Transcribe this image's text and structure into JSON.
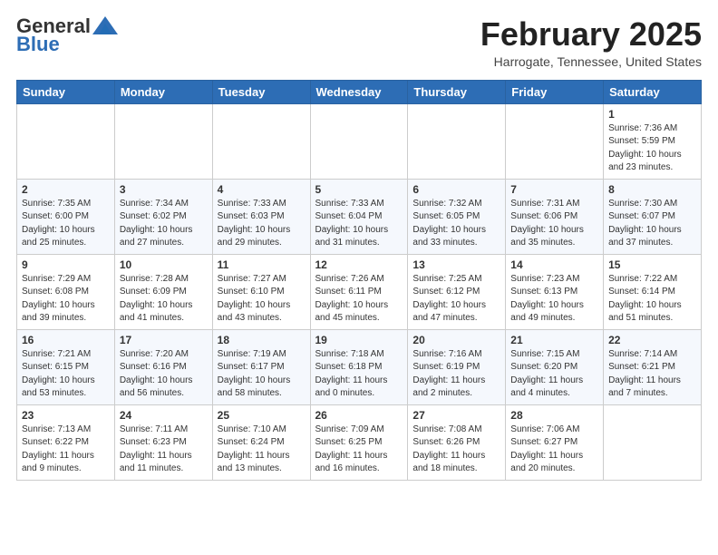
{
  "header": {
    "logo_general": "General",
    "logo_blue": "Blue",
    "month": "February 2025",
    "location": "Harrogate, Tennessee, United States"
  },
  "weekdays": [
    "Sunday",
    "Monday",
    "Tuesday",
    "Wednesday",
    "Thursday",
    "Friday",
    "Saturday"
  ],
  "weeks": [
    [
      {
        "day": "",
        "info": ""
      },
      {
        "day": "",
        "info": ""
      },
      {
        "day": "",
        "info": ""
      },
      {
        "day": "",
        "info": ""
      },
      {
        "day": "",
        "info": ""
      },
      {
        "day": "",
        "info": ""
      },
      {
        "day": "1",
        "info": "Sunrise: 7:36 AM\nSunset: 5:59 PM\nDaylight: 10 hours and 23 minutes."
      }
    ],
    [
      {
        "day": "2",
        "info": "Sunrise: 7:35 AM\nSunset: 6:00 PM\nDaylight: 10 hours and 25 minutes."
      },
      {
        "day": "3",
        "info": "Sunrise: 7:34 AM\nSunset: 6:02 PM\nDaylight: 10 hours and 27 minutes."
      },
      {
        "day": "4",
        "info": "Sunrise: 7:33 AM\nSunset: 6:03 PM\nDaylight: 10 hours and 29 minutes."
      },
      {
        "day": "5",
        "info": "Sunrise: 7:33 AM\nSunset: 6:04 PM\nDaylight: 10 hours and 31 minutes."
      },
      {
        "day": "6",
        "info": "Sunrise: 7:32 AM\nSunset: 6:05 PM\nDaylight: 10 hours and 33 minutes."
      },
      {
        "day": "7",
        "info": "Sunrise: 7:31 AM\nSunset: 6:06 PM\nDaylight: 10 hours and 35 minutes."
      },
      {
        "day": "8",
        "info": "Sunrise: 7:30 AM\nSunset: 6:07 PM\nDaylight: 10 hours and 37 minutes."
      }
    ],
    [
      {
        "day": "9",
        "info": "Sunrise: 7:29 AM\nSunset: 6:08 PM\nDaylight: 10 hours and 39 minutes."
      },
      {
        "day": "10",
        "info": "Sunrise: 7:28 AM\nSunset: 6:09 PM\nDaylight: 10 hours and 41 minutes."
      },
      {
        "day": "11",
        "info": "Sunrise: 7:27 AM\nSunset: 6:10 PM\nDaylight: 10 hours and 43 minutes."
      },
      {
        "day": "12",
        "info": "Sunrise: 7:26 AM\nSunset: 6:11 PM\nDaylight: 10 hours and 45 minutes."
      },
      {
        "day": "13",
        "info": "Sunrise: 7:25 AM\nSunset: 6:12 PM\nDaylight: 10 hours and 47 minutes."
      },
      {
        "day": "14",
        "info": "Sunrise: 7:23 AM\nSunset: 6:13 PM\nDaylight: 10 hours and 49 minutes."
      },
      {
        "day": "15",
        "info": "Sunrise: 7:22 AM\nSunset: 6:14 PM\nDaylight: 10 hours and 51 minutes."
      }
    ],
    [
      {
        "day": "16",
        "info": "Sunrise: 7:21 AM\nSunset: 6:15 PM\nDaylight: 10 hours and 53 minutes."
      },
      {
        "day": "17",
        "info": "Sunrise: 7:20 AM\nSunset: 6:16 PM\nDaylight: 10 hours and 56 minutes."
      },
      {
        "day": "18",
        "info": "Sunrise: 7:19 AM\nSunset: 6:17 PM\nDaylight: 10 hours and 58 minutes."
      },
      {
        "day": "19",
        "info": "Sunrise: 7:18 AM\nSunset: 6:18 PM\nDaylight: 11 hours and 0 minutes."
      },
      {
        "day": "20",
        "info": "Sunrise: 7:16 AM\nSunset: 6:19 PM\nDaylight: 11 hours and 2 minutes."
      },
      {
        "day": "21",
        "info": "Sunrise: 7:15 AM\nSunset: 6:20 PM\nDaylight: 11 hours and 4 minutes."
      },
      {
        "day": "22",
        "info": "Sunrise: 7:14 AM\nSunset: 6:21 PM\nDaylight: 11 hours and 7 minutes."
      }
    ],
    [
      {
        "day": "23",
        "info": "Sunrise: 7:13 AM\nSunset: 6:22 PM\nDaylight: 11 hours and 9 minutes."
      },
      {
        "day": "24",
        "info": "Sunrise: 7:11 AM\nSunset: 6:23 PM\nDaylight: 11 hours and 11 minutes."
      },
      {
        "day": "25",
        "info": "Sunrise: 7:10 AM\nSunset: 6:24 PM\nDaylight: 11 hours and 13 minutes."
      },
      {
        "day": "26",
        "info": "Sunrise: 7:09 AM\nSunset: 6:25 PM\nDaylight: 11 hours and 16 minutes."
      },
      {
        "day": "27",
        "info": "Sunrise: 7:08 AM\nSunset: 6:26 PM\nDaylight: 11 hours and 18 minutes."
      },
      {
        "day": "28",
        "info": "Sunrise: 7:06 AM\nSunset: 6:27 PM\nDaylight: 11 hours and 20 minutes."
      },
      {
        "day": "",
        "info": ""
      }
    ]
  ]
}
